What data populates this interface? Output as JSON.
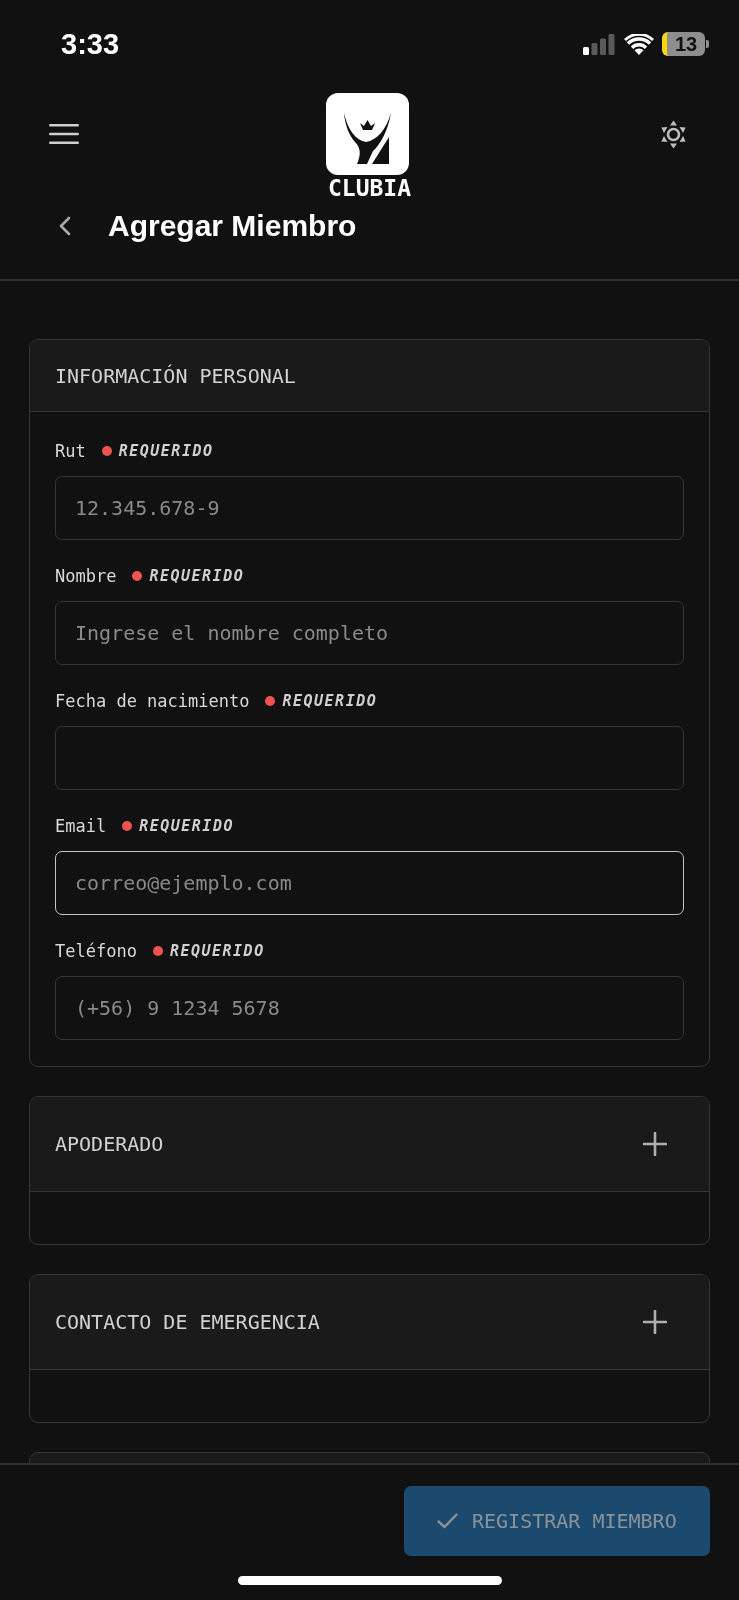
{
  "status_bar": {
    "time": "3:33",
    "battery": "13"
  },
  "header": {
    "logo_text": "CLUBIA",
    "title": "Agregar Miembro"
  },
  "sections": [
    {
      "title": "INFORMACIÓN PERSONAL",
      "expanded": true,
      "fields": [
        {
          "label": "Rut",
          "required_label": "REQUERIDO",
          "placeholder": "12.345.678-9",
          "focused": false
        },
        {
          "label": "Nombre",
          "required_label": "REQUERIDO",
          "placeholder": "Ingrese el nombre completo",
          "focused": false
        },
        {
          "label": "Fecha de nacimiento",
          "required_label": "REQUERIDO",
          "focused": false
        },
        {
          "label": "Email",
          "required_label": "REQUERIDO",
          "placeholder": "correo@ejemplo.com",
          "focused": true
        },
        {
          "label": "Teléfono",
          "required_label": "REQUERIDO",
          "placeholder": "(+56) 9 1234 5678",
          "focused": false
        }
      ]
    },
    {
      "title": "APODERADO",
      "expanded": false
    },
    {
      "title": "CONTACTO DE EMERGENCIA",
      "expanded": false
    }
  ],
  "footer": {
    "submit": {
      "label": "REGISTRAR MIEMBRO",
      "disabled": true
    }
  }
}
